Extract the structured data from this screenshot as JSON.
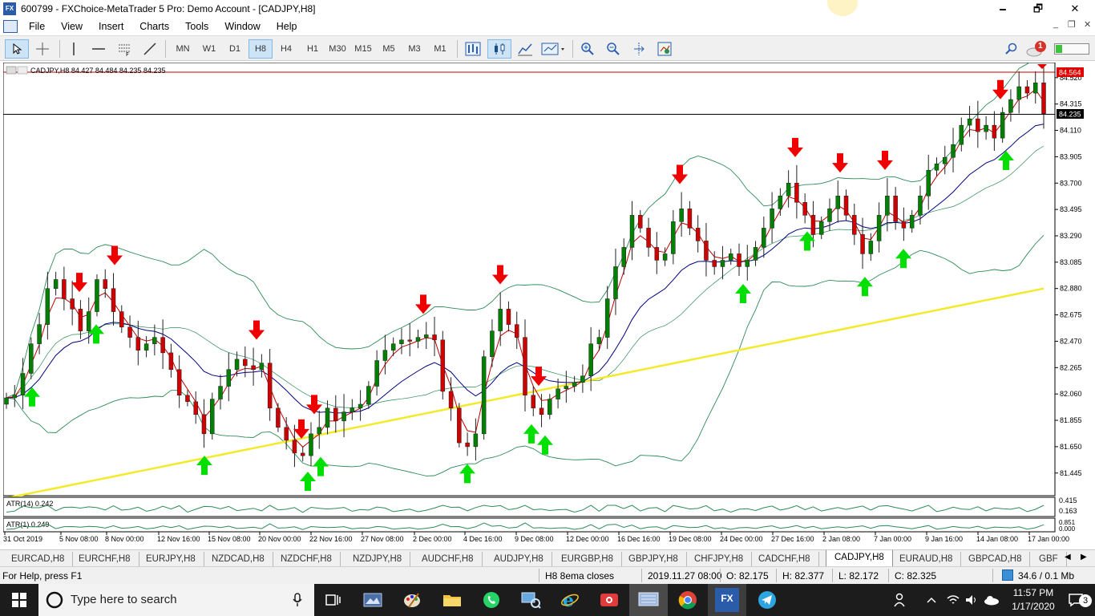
{
  "window": {
    "title": "600799 - FXChoice-MetaTrader 5 Pro: Demo Account - [CADJPY,H8]",
    "app_icon_text": "FX",
    "minimize": "🗕",
    "restore": "🗗",
    "close": "✕"
  },
  "menu": {
    "items": [
      "File",
      "View",
      "Insert",
      "Charts",
      "Tools",
      "Window",
      "Help"
    ],
    "mdi_min": "_",
    "mdi_restore": "❐",
    "mdi_close": "✕"
  },
  "toolbar": {
    "timeframes": [
      "MN",
      "W1",
      "D1",
      "H8",
      "H4",
      "H1",
      "M30",
      "M15",
      "M5",
      "M3",
      "M1"
    ],
    "active_timeframe": "H8",
    "notification_count": "1"
  },
  "chart": {
    "info_label": "CADJPY,H8  84.427 84.484 84.235 84.235",
    "current_bid": "84.235",
    "ask_label": "84.564",
    "price_ticks": [
      "84.520",
      "84.315",
      "84.110",
      "83.905",
      "83.700",
      "83.495",
      "83.290",
      "83.085",
      "82.880",
      "82.675",
      "82.470",
      "82.265",
      "82.060",
      "81.855",
      "81.650",
      "81.445"
    ],
    "time_labels": [
      "31 Oct 2019",
      "5 Nov 08:00",
      "8 Nov 00:00",
      "12 Nov 16:00",
      "15 Nov 08:00",
      "20 Nov 00:00",
      "22 Nov 16:00",
      "27 Nov 08:00",
      "2 Dec 00:00",
      "4 Dec 16:00",
      "9 Dec 08:00",
      "12 Dec 00:00",
      "16 Dec 16:00",
      "19 Dec 08:00",
      "24 Dec 00:00",
      "27 Dec 16:00",
      "2 Jan 08:00",
      "7 Jan 00:00",
      "9 Jan 16:00",
      "14 Jan 08:00",
      "17 Jan 00:00"
    ],
    "atr14_label": "ATR(14) 0.242",
    "atr14_ticks": [
      "0.415",
      "0.163"
    ],
    "atr1_label": "ATR(1) 0.249",
    "atr1_ticks": [
      "0.851",
      "0.000"
    ],
    "colors": {
      "bull": "#008000",
      "bear": "#d00000",
      "arrow_up": "#00e000",
      "arrow_down": "#ee0000",
      "ema_fast": "#c00000",
      "ema_mid": "#000080",
      "ema_slow": "#f2ea2a",
      "bands": "#2e8b57"
    }
  },
  "chart_data": {
    "type": "candlestick",
    "symbol": "CADJPY",
    "timeframe": "H8",
    "ylim": [
      81.3,
      84.6
    ],
    "closes": [
      82.03,
      82.05,
      82.22,
      82.45,
      82.6,
      82.88,
      82.95,
      82.8,
      82.72,
      82.55,
      82.7,
      82.95,
      82.88,
      82.7,
      82.58,
      82.5,
      82.4,
      82.45,
      82.5,
      82.38,
      82.25,
      82.05,
      82.0,
      81.9,
      81.75,
      82.02,
      82.12,
      82.25,
      82.33,
      82.28,
      82.25,
      82.3,
      81.95,
      81.8,
      81.7,
      81.6,
      81.58,
      81.75,
      81.8,
      81.95,
      81.85,
      81.92,
      81.95,
      81.98,
      82.12,
      82.32,
      82.4,
      82.45,
      82.48,
      82.47,
      82.5,
      82.52,
      82.48,
      82.08,
      81.95,
      81.68,
      81.65,
      81.75,
      82.35,
      82.55,
      82.72,
      82.6,
      82.5,
      82.05,
      81.95,
      81.9,
      82.02,
      82.1,
      82.12,
      82.15,
      82.2,
      82.45,
      82.5,
      82.8,
      83.05,
      83.2,
      83.45,
      83.35,
      83.2,
      83.1,
      83.15,
      83.4,
      83.5,
      83.35,
      83.25,
      83.1,
      83.05,
      83.1,
      83.15,
      83.05,
      83.1,
      83.2,
      83.35,
      83.5,
      83.6,
      83.7,
      83.55,
      83.45,
      83.3,
      83.4,
      83.5,
      83.6,
      83.45,
      83.3,
      83.15,
      83.25,
      83.45,
      83.6,
      83.4,
      83.35,
      83.45,
      83.6,
      83.8,
      83.85,
      83.9,
      84.0,
      84.15,
      84.2,
      84.1,
      84.15,
      84.05,
      84.25,
      84.35,
      84.45,
      84.4,
      84.48,
      84.24
    ],
    "arrows_down": [
      95,
      139,
      316,
      372,
      388,
      524,
      620,
      668,
      844,
      988,
      1044,
      1100,
      1244,
      1300
    ],
    "arrows_up": [
      36,
      116,
      251,
      380,
      396,
      579,
      659,
      676,
      923,
      1003,
      1075,
      1123,
      1251
    ]
  },
  "tabs": [
    "EURCAD,H8",
    "EURCHF,H8",
    "EURJPY,H8",
    "NZDCAD,H8",
    "NZDCHF,H8",
    "NZDJPY,H8",
    "AUDCHF,H8",
    "AUDJPY,H8",
    "EURGBP,H8",
    "GBPJPY,H8",
    "CHFJPY,H8",
    "CADCHF,H8",
    "CADJPY,H8",
    "EURAUD,H8",
    "GBPCAD,H8",
    "GBF"
  ],
  "active_tab": "CADJPY,H8",
  "status": {
    "help": "For Help, press F1",
    "profile": "H8 8ema closes",
    "datetime": "2019.11.27 08:00",
    "open": "O: 82.175",
    "high": "H: 82.377",
    "low": "L: 82.172",
    "close": "C: 82.325",
    "traffic": "34.6 / 0.1 Mb"
  },
  "taskbar": {
    "search_placeholder": "Type here to search",
    "time": "11:57 PM",
    "date": "1/17/2020",
    "notifications": "3",
    "fx_label": "FX"
  }
}
